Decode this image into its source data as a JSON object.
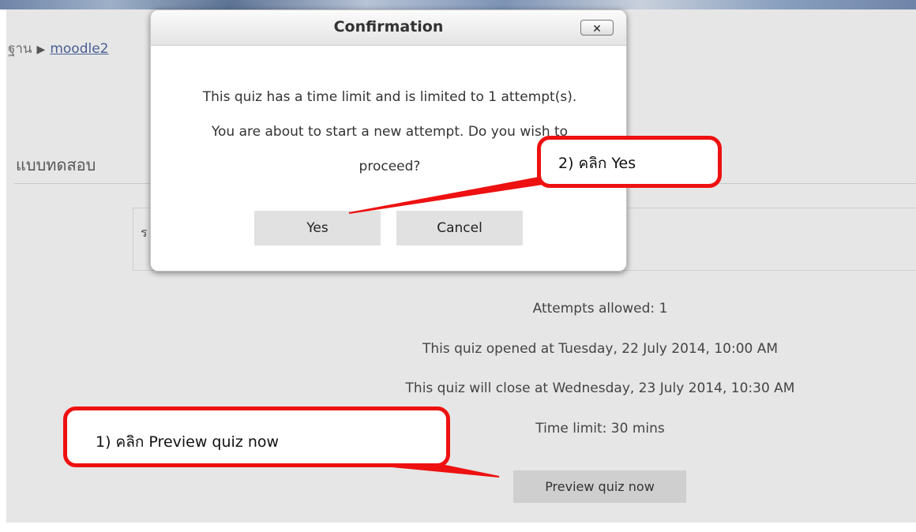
{
  "breadcrumb": {
    "prefix": "ฐาน",
    "link": "moodle2"
  },
  "section": {
    "title": "แบบทดสอบ",
    "box_text": "ร"
  },
  "quiz_info": {
    "attempts": "Attempts allowed: 1",
    "opened": "This quiz opened at Tuesday, 22 July 2014, 10:00 AM",
    "closes": "This quiz will close at Wednesday, 23 July 2014, 10:30 AM",
    "time_limit": "Time limit: 30 mins"
  },
  "preview_button": "Preview quiz now",
  "dialog": {
    "title": "Confirmation",
    "close_symbol": "✕",
    "message": "This quiz has a time limit and is limited to 1 attempt(s). You are about to start a new attempt. Do you wish to proceed?",
    "yes": "Yes",
    "cancel": "Cancel"
  },
  "annotations": {
    "step1": "1) คลิก Preview quiz now",
    "step2": "2) คลิก Yes",
    "color": "#ee1111"
  }
}
